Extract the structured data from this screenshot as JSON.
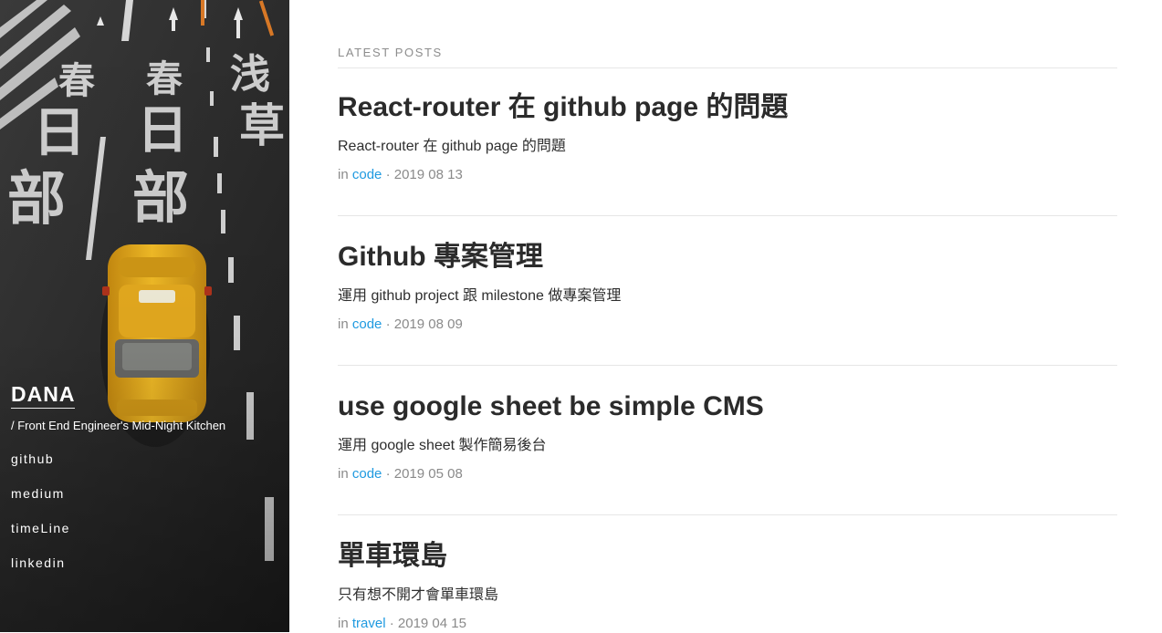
{
  "sidebar": {
    "site_name": "DANA",
    "tagline": "/ Front End Engineer's Mid-Night Kitchen",
    "nav": [
      {
        "label": "github"
      },
      {
        "label": "medium"
      },
      {
        "label": "timeLine"
      },
      {
        "label": "linkedin"
      }
    ],
    "road_text": [
      "春",
      "日",
      "部",
      "春",
      "日",
      "部",
      "浅",
      "草"
    ],
    "taxi_color": "#f2b51c"
  },
  "main": {
    "section_title": "LATEST POSTS",
    "in_label": "in",
    "separator": "·",
    "posts": [
      {
        "title": "React-router 在 github page 的問題",
        "description": "React-router 在 github page 的問題",
        "category": "code",
        "date": "2019 08 13"
      },
      {
        "title": "Github 專案管理",
        "description": "運用 github project 跟 milestone 做專案管理",
        "category": "code",
        "date": "2019 08 09"
      },
      {
        "title": "use google sheet be simple CMS",
        "description": "運用 google sheet 製作簡易後台",
        "category": "code",
        "date": "2019 05 08"
      },
      {
        "title": "單車環島",
        "description": "只有想不開才會單車環島",
        "category": "travel",
        "date": "2019 04 15"
      }
    ]
  },
  "colors": {
    "link": "#1f9ae0",
    "title": "#2b2b2b",
    "meta": "#8a8a8a",
    "sidebar_bg": "#2a2a2a"
  }
}
